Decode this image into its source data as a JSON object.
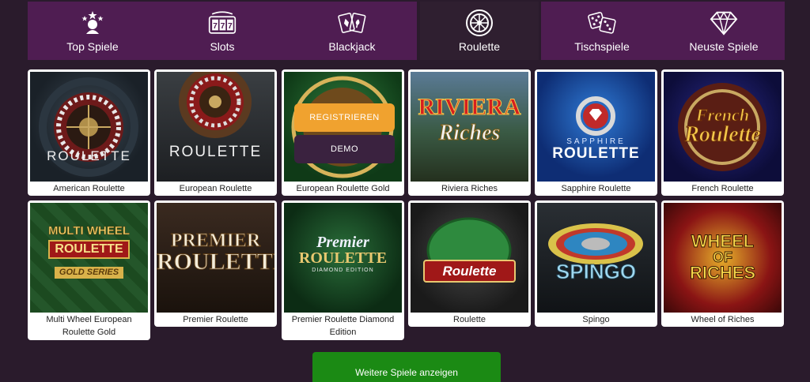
{
  "nav": {
    "items": [
      {
        "label": "Top Spiele",
        "icon": "top-games-icon"
      },
      {
        "label": "Slots",
        "icon": "slots-icon"
      },
      {
        "label": "Blackjack",
        "icon": "blackjack-cards-icon"
      },
      {
        "label": "Roulette",
        "icon": "roulette-wheel-icon",
        "active": true
      },
      {
        "label": "Tischspiele",
        "icon": "dice-icon"
      },
      {
        "label": "Neuste Spiele",
        "icon": "diamond-icon"
      }
    ]
  },
  "colors": {
    "nav_bg": "#4f1d52",
    "nav_active_bg": "#2f1f30",
    "page_bg": "#2a1b2c",
    "register": "#f0a22f",
    "demo": "#3a223f",
    "more": "#1b8a14"
  },
  "games": [
    {
      "title": "American Roulette",
      "logo": "ROULETTE"
    },
    {
      "title": "European Roulette",
      "logo": "ROULETTE"
    },
    {
      "title": "European Roulette Gold",
      "logo": ""
    },
    {
      "title": "Riviera Riches",
      "logo_line1": "RIVIERA",
      "logo_line2": "Riches"
    },
    {
      "title": "Sapphire Roulette",
      "logo_line1": "SAPPHIRE",
      "logo_line2": "ROULETTE"
    },
    {
      "title": "French Roulette",
      "logo_line1": "French",
      "logo_line2": "Roulette"
    },
    {
      "title": "Multi Wheel European Roulette Gold",
      "logo_line1": "MULTI WHEEL",
      "logo_line2": "ROULETTE",
      "logo_line3": "GOLD SERIES"
    },
    {
      "title": "Premier Roulette",
      "logo_line1": "PREMIER",
      "logo_line2": "ROULETTE"
    },
    {
      "title": "Premier Roulette Diamond Edition",
      "logo_line1": "Premier",
      "logo_line2": "ROULETTE",
      "logo_line3": "DIAMOND EDITION"
    },
    {
      "title": "Roulette",
      "logo": "Roulette"
    },
    {
      "title": "Spingo",
      "logo": "SPINGO"
    },
    {
      "title": "Wheel of Riches",
      "logo_line1": "WHEEL",
      "logo_line2": "OF",
      "logo_line3": "RICHES"
    }
  ],
  "overlay": {
    "register": "REGISTRIEREN",
    "demo": "DEMO"
  },
  "more_button": "Weitere Spiele anzeigen"
}
